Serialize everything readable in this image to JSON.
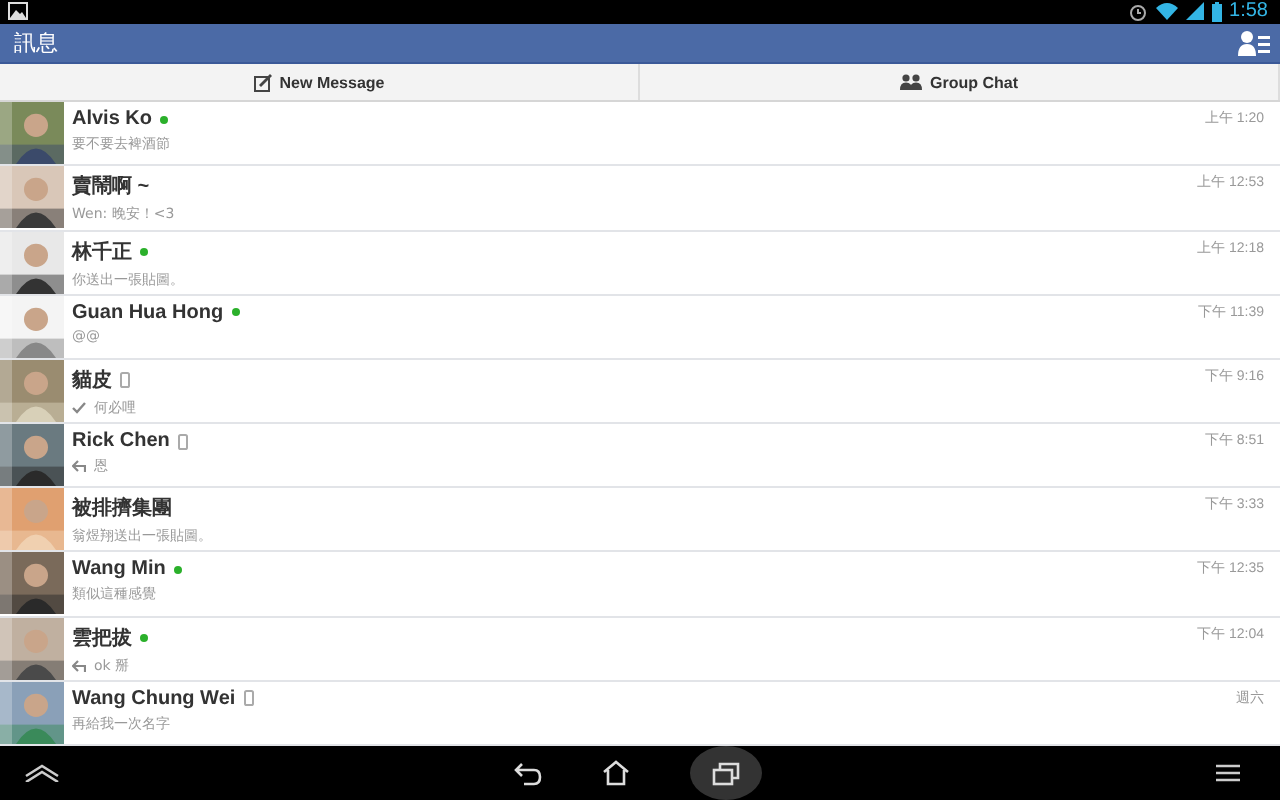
{
  "status_bar": {
    "time": "1:58"
  },
  "header": {
    "title": "訊息"
  },
  "toolbar": {
    "buttons": [
      {
        "kind": "compose",
        "label": "New Message"
      },
      {
        "kind": "group",
        "label": "Group Chat"
      }
    ]
  },
  "conversations": [
    {
      "name": "Alvis Ko",
      "online": true,
      "mobile": false,
      "preview": "要不要去裨酒節",
      "seen": false,
      "replied": false,
      "time": "上午 1:20"
    },
    {
      "name": "賣鬧啊 ~",
      "online": false,
      "mobile": false,
      "preview": "Wen: 晚安！<3",
      "seen": false,
      "replied": false,
      "time": "上午 12:53"
    },
    {
      "name": "林千正",
      "online": true,
      "mobile": false,
      "preview": "你送出一張貼圖。",
      "seen": false,
      "replied": false,
      "time": "上午 12:18"
    },
    {
      "name": "Guan Hua Hong",
      "online": true,
      "mobile": false,
      "preview": "@@",
      "seen": false,
      "replied": false,
      "time": "下午 11:39"
    },
    {
      "name": "貓皮",
      "online": false,
      "mobile": true,
      "preview": "何必哩",
      "seen": true,
      "replied": false,
      "time": "下午 9:16"
    },
    {
      "name": "Rick Chen",
      "online": false,
      "mobile": true,
      "preview": "恩",
      "seen": false,
      "replied": true,
      "time": "下午 8:51"
    },
    {
      "name": "被排擠集團",
      "online": false,
      "mobile": false,
      "preview": "翁煜翔送出一張貼圖。",
      "seen": false,
      "replied": false,
      "time": "下午 3:33"
    },
    {
      "name": "Wang Min",
      "online": true,
      "mobile": false,
      "preview": "類似這種感覺",
      "seen": false,
      "replied": false,
      "time": "下午 12:35"
    },
    {
      "name": "雲把拔",
      "online": true,
      "mobile": false,
      "preview": "ok 掰",
      "seen": false,
      "replied": true,
      "time": "下午 12:04"
    },
    {
      "name": "Wang Chung Wei",
      "online": false,
      "mobile": true,
      "preview": "再給我一次名字",
      "seen": false,
      "replied": false,
      "time": "週六"
    }
  ]
}
